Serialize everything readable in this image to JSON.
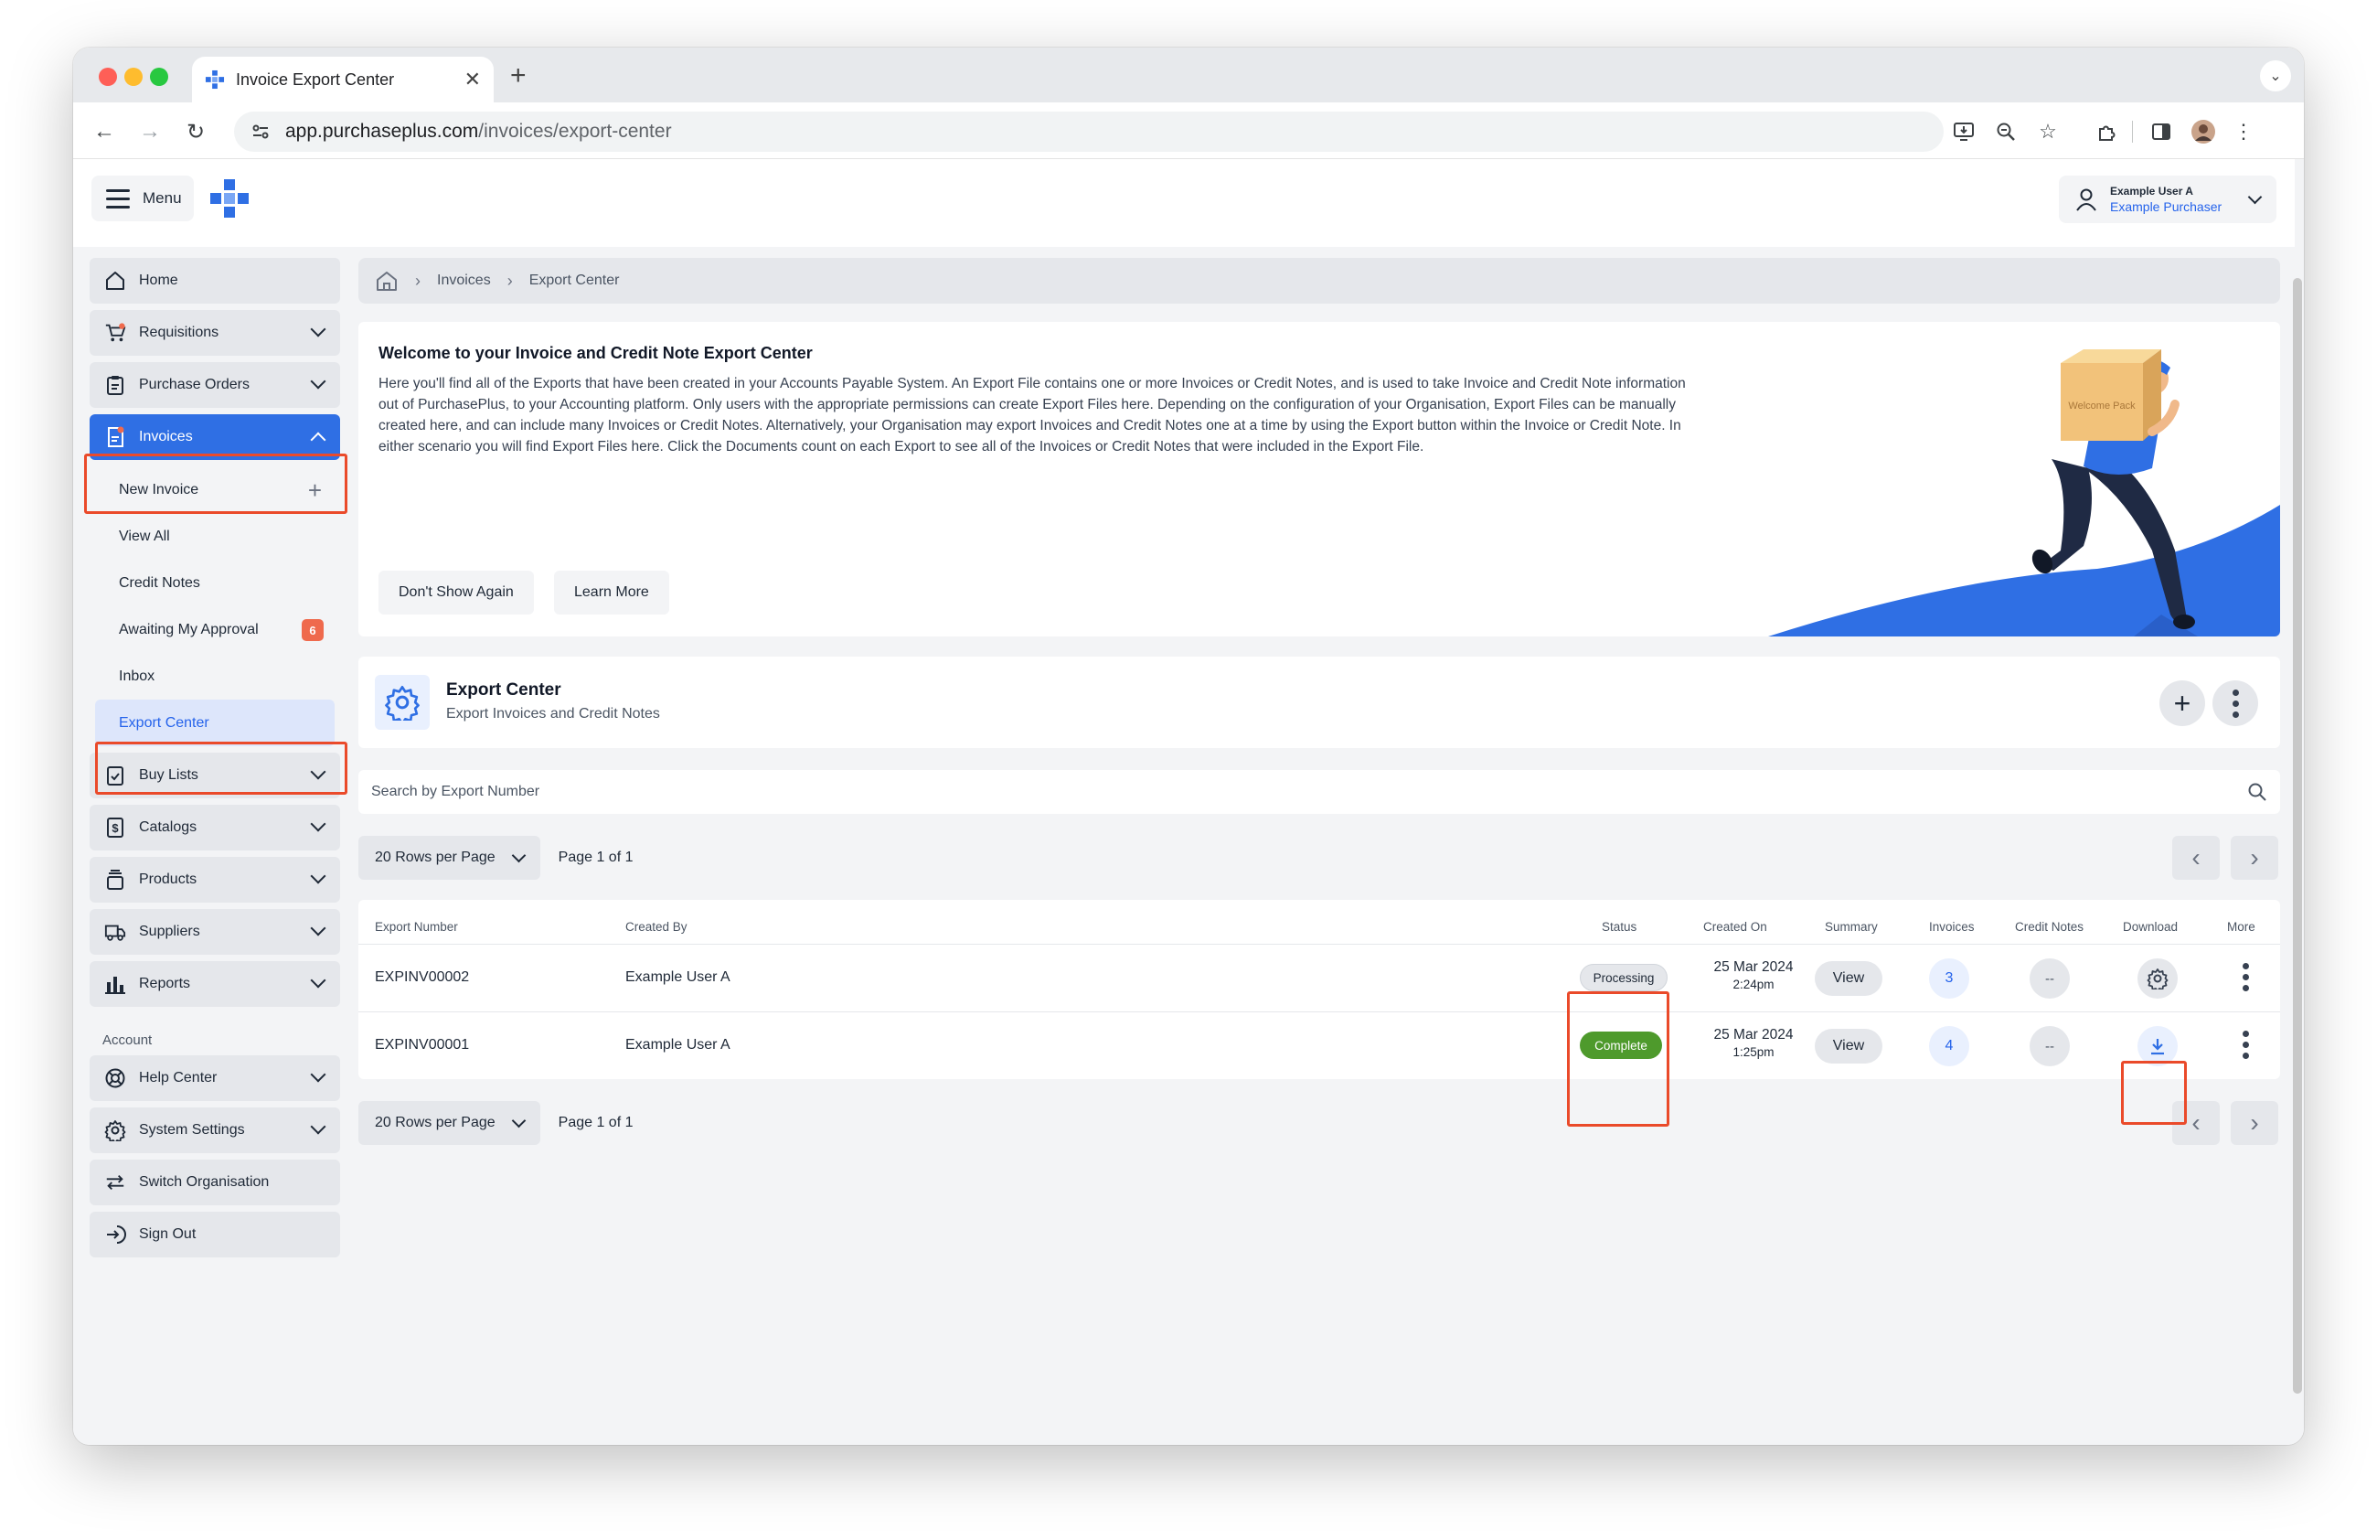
{
  "browser": {
    "tab_title": "Invoice Export Center",
    "url_host": "app.purchaseplus.com",
    "url_path": "/invoices/export-center"
  },
  "header": {
    "menu_label": "Menu",
    "user_name": "Example User A",
    "user_role": "Example Purchaser"
  },
  "sidebar": {
    "home": "Home",
    "requisitions": "Requisitions",
    "purchase_orders": "Purchase Orders",
    "invoices": "Invoices",
    "sub": {
      "new_invoice": "New Invoice",
      "view_all": "View All",
      "credit_notes": "Credit Notes",
      "awaiting_approval": "Awaiting My Approval",
      "awaiting_count": "6",
      "inbox": "Inbox",
      "export_center": "Export Center"
    },
    "buy_lists": "Buy Lists",
    "catalogs": "Catalogs",
    "products": "Products",
    "suppliers": "Suppliers",
    "reports": "Reports",
    "account_label": "Account",
    "help_center": "Help Center",
    "system_settings": "System Settings",
    "switch_organisation": "Switch Organisation",
    "sign_out": "Sign Out"
  },
  "breadcrumb": {
    "invoices": "Invoices",
    "export_center": "Export Center"
  },
  "welcome": {
    "title": "Welcome to your Invoice and Credit Note Export Center",
    "body": "Here you'll find all of the Exports that have been created in your Accounts Payable System. An Export File contains one or more Invoices or Credit Notes, and is used to take Invoice and Credit Note information out of PurchasePlus, to your Accounting platform. Only users with the appropriate permissions can create Export Files here. Depending on the configuration of your Organisation, Export Files can be manually created here, and can include many Invoices or Credit Notes. Alternatively, your Organisation may export Invoices and Credit Notes one at a time by using the Export button within the Invoice or Credit Note. In either scenario you will find Export Files here. Click the Documents count on each Export to see all of the Invoices or Credit Notes that were included in the Export File.",
    "dont_show": "Don't Show Again",
    "learn_more": "Learn More",
    "package_text": "Welcome Pack"
  },
  "export_center": {
    "title": "Export Center",
    "subtitle": "Export Invoices and Credit Notes"
  },
  "search": {
    "placeholder": "Search by Export Number"
  },
  "pagination": {
    "rows_per_page": "20 Rows per Page",
    "page_info": "Page 1 of 1"
  },
  "table": {
    "headers": {
      "export_number": "Export Number",
      "created_by": "Created By",
      "status": "Status",
      "created_on": "Created On",
      "summary": "Summary",
      "invoices": "Invoices",
      "credit_notes": "Credit Notes",
      "download": "Download",
      "more": "More"
    },
    "rows": [
      {
        "export_number": "EXPINV00002",
        "created_by": "Example User A",
        "status": "Processing",
        "date": "25 Mar 2024",
        "time": "2:24pm",
        "summary": "View",
        "invoices": "3",
        "credit_notes": "--",
        "download_icon": "gear-icon"
      },
      {
        "export_number": "EXPINV00001",
        "created_by": "Example User A",
        "status": "Complete",
        "date": "25 Mar 2024",
        "time": "1:25pm",
        "summary": "View",
        "invoices": "4",
        "credit_notes": "--",
        "download_icon": "download-icon"
      }
    ]
  },
  "colors": {
    "accent": "#2f6fe4",
    "complete": "#4e9a2c",
    "highlight": "#ea4a2a",
    "badge": "#ef6a4d"
  }
}
